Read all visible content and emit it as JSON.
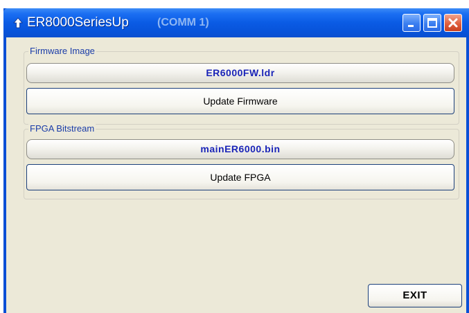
{
  "window": {
    "title": "ER8000SeriesUp",
    "subtitle": "(COMM 1)",
    "icon": "app-arrow-icon",
    "controls": [
      "minimize-icon",
      "maximize-icon",
      "close-icon"
    ]
  },
  "firmware": {
    "group_label": "Firmware Image",
    "file_name": "ER6000FW.ldr",
    "button_label": "Update Firmware"
  },
  "fpga": {
    "group_label": "FPGA Bitstream",
    "file_name": "mainER6000.bin",
    "button_label": "Update FPGA"
  },
  "footer": {
    "exit_label": "EXIT"
  },
  "colors": {
    "titlebar": "#0a5be4",
    "client_background": "#ece9d8",
    "file_text": "#1a24b8",
    "group_label": "#1a3ca8"
  }
}
